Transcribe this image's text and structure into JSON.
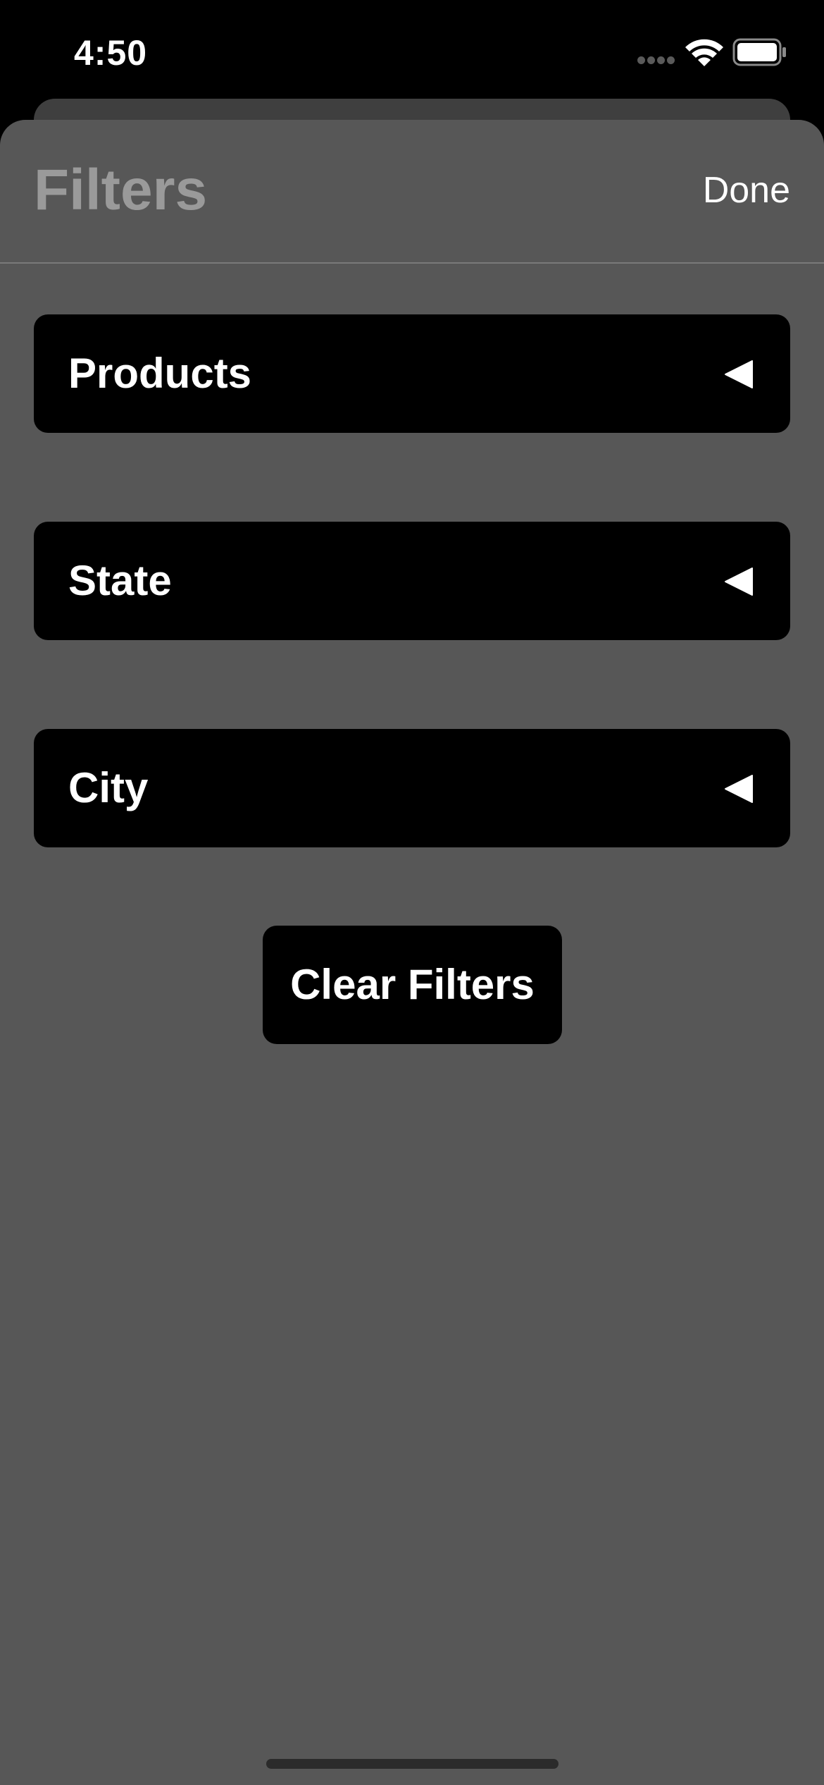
{
  "status_bar": {
    "time": "4:50",
    "signal_icon": "cellular-signal-icon",
    "wifi_icon": "wifi-icon",
    "battery_icon": "battery-icon"
  },
  "sheet": {
    "title": "Filters",
    "done_label": "Done"
  },
  "filters": [
    {
      "label": "Products",
      "icon": "triangle-left-icon"
    },
    {
      "label": "State",
      "icon": "triangle-left-icon"
    },
    {
      "label": "City",
      "icon": "triangle-left-icon"
    }
  ],
  "actions": {
    "clear_label": "Clear Filters"
  },
  "colors": {
    "sheet_background": "#575757",
    "row_background": "#000000",
    "title_color": "#9a9a9a",
    "text_color": "#ffffff"
  }
}
